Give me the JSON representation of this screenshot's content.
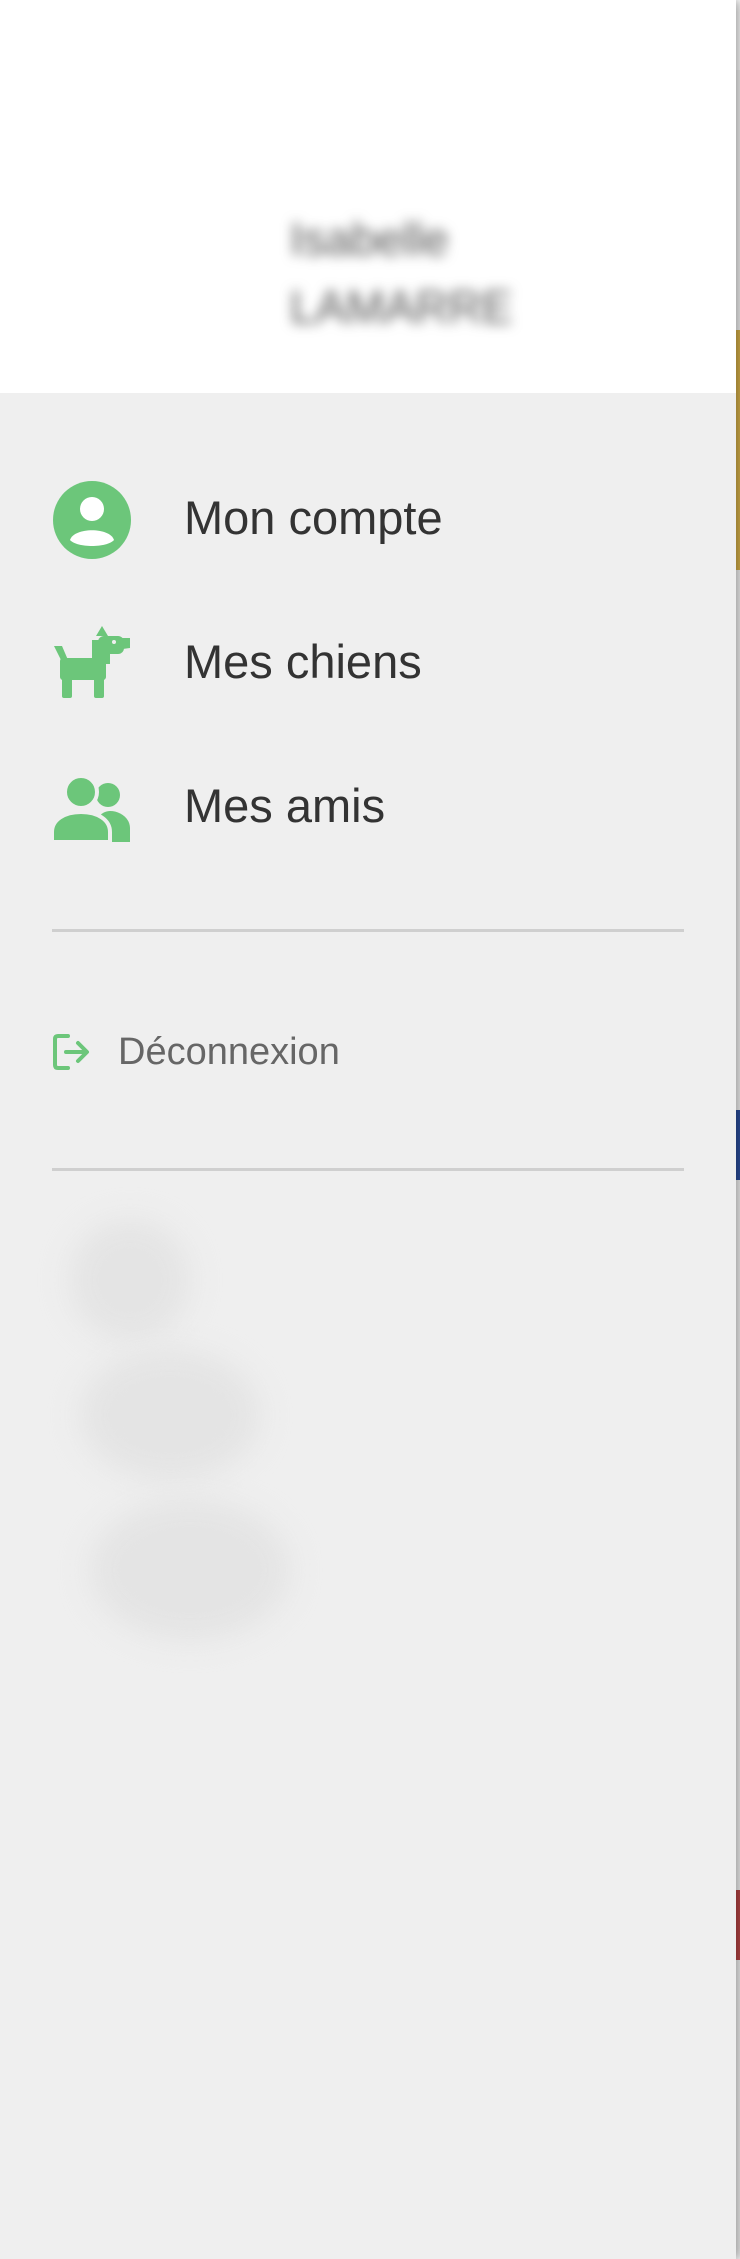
{
  "user": {
    "first_name": "Isabelle",
    "last_name": "LAMARRE"
  },
  "menu": {
    "items": [
      {
        "label": "Mon compte",
        "icon": "account-circle-icon"
      },
      {
        "label": "Mes chiens",
        "icon": "dog-icon"
      },
      {
        "label": "Mes amis",
        "icon": "friends-icon"
      }
    ],
    "logout": {
      "label": "Déconnexion",
      "icon": "logout-icon"
    }
  },
  "colors": {
    "accent": "#6cc67a",
    "drawer_bg": "#efefef",
    "header_bg": "#ffffff",
    "text": "#333333",
    "muted_text": "#666666",
    "divider": "#cfcfcf"
  }
}
